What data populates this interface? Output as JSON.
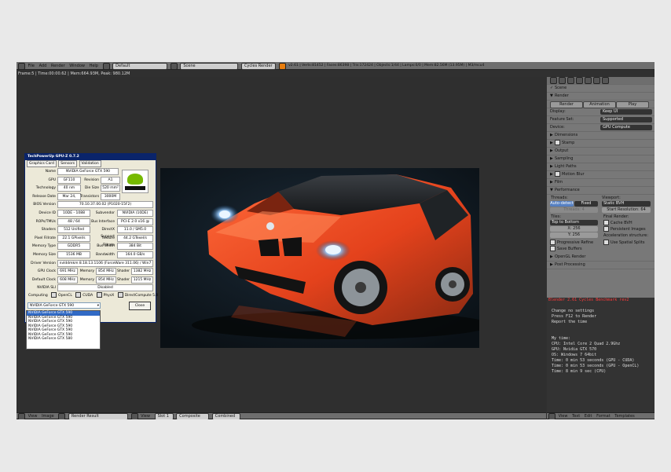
{
  "topbar": {
    "menus": [
      "File",
      "Add",
      "Render",
      "Window",
      "Help"
    ],
    "screen": "Default",
    "scene": "Scene",
    "engine": "Cycles Render",
    "stats": "v2.61 | Verts:81452 | Faces:86398 | Tris:172424 | Objects:1/44 | Lamps:0/0 | Mem:82.56M (13.95M) | M3/mcu4"
  },
  "viewport_info": "Frame:5 | Time:00:00.62 | Mem:664.93M, Peak: 980.12M",
  "gpuz": {
    "title": "TechPowerUp GPU-Z 0.7.2",
    "tabs": [
      "Graphics Card",
      "Sensors",
      "Validation"
    ],
    "rows": [
      {
        "l": "Name",
        "v": "NVIDIA GeForce GTX 590"
      },
      {
        "l": "GPU",
        "v": "GF110",
        "l2": "Revision",
        "v2": "A1"
      },
      {
        "l": "Technology",
        "v": "40 nm",
        "l2": "Die Size",
        "v2": "520 mm²"
      },
      {
        "l": "Release Date",
        "v": "Mar 24, 2011",
        "l2": "Transistors",
        "v2": "3000M"
      },
      {
        "l": "BIOS Version",
        "v": "70.10.37.00.02 (P1020-15F2)"
      },
      {
        "l": "Device ID",
        "v": "10DE - 1088",
        "l2": "Subvendor",
        "v2": "NVIDIA (10DE)"
      },
      {
        "l": "ROPs/TMUs",
        "v": "48 / 64",
        "l2": "Bus Interface",
        "v2": "PCI-E 2.0 x16 @ x16 1.1"
      },
      {
        "l": "Shaders",
        "v": "512 Unified",
        "l2": "DirectX Support",
        "v2": "11.0 / SM5.0"
      },
      {
        "l": "Pixel Fillrate",
        "v": "22.1 GPixel/s",
        "l2": "Texture Fillrate",
        "v2": "44.2 GTexel/s"
      },
      {
        "l": "Memory Type",
        "v": "GDDR5",
        "l2": "Bus Width",
        "v2": "384 Bit"
      },
      {
        "l": "Memory Size",
        "v": "1536 MB",
        "l2": "Bandwidth",
        "v2": "164.0 GB/s"
      },
      {
        "l": "Driver Version",
        "v": "nvlddmkm 8.18.13.1106 (ForceWare 311.06) / Win7 64"
      },
      {
        "l": "GPU Clock",
        "v": "691 MHz",
        "l2": "Memory",
        "v2": "854 MHz",
        "l3": "Shader",
        "v3": "1382 MHz"
      },
      {
        "l": "Default Clock",
        "v": "608 MHz",
        "l2": "Memory",
        "v2": "854 MHz",
        "l3": "Shader",
        "v3": "1215 MHz"
      },
      {
        "l": "NVIDIA SLI",
        "v": "Disabled"
      }
    ],
    "computing_label": "Computing",
    "computing": [
      "OpenCL",
      "CUDA",
      "PhysX",
      "DirectCompute 5.0"
    ],
    "select_value": "NVIDIA GeForce GTX 590",
    "close_label": "Close",
    "options": [
      "NVIDIA GeForce GTX 590",
      "NVIDIA GeForce GTX 590",
      "NVIDIA GeForce GTX 590",
      "NVIDIA GeForce GTX 590",
      "NVIDIA GeForce GTX 590",
      "NVIDIA GeForce GTX 590",
      "NVIDIA GeForce GTX 580"
    ]
  },
  "props": {
    "scene": "Scene",
    "render_header": "Render",
    "buttons": [
      "Render",
      "Animation",
      "Play"
    ],
    "display_label": "Display:",
    "display": "Keep UI",
    "feature_label": "Feature Set:",
    "feature": "Supported",
    "device_label": "Device:",
    "device": "GPU Compute",
    "panels": [
      "Dimensions",
      "Stamp",
      "Output",
      "Sampling",
      "Light Paths",
      "Motion Blur",
      "Film",
      "Performance"
    ],
    "threads_label": "Threads:",
    "auto": "Auto-detect",
    "fixed": "Fixed",
    "threads_val": "Threads: 4",
    "viewport_label": "Viewport:",
    "bvh": "Static BVH",
    "start_res": "Start Resolution: 64",
    "tiles_label": "Tiles:",
    "order": "Top to Bottom",
    "tx": "X: 256",
    "ty": "Y: 256",
    "final_label": "Final Render:",
    "cache": "Cache BVH",
    "persist": "Persistent Images",
    "prog": "Progressive Refine",
    "save": "Save Buffers",
    "accel_label": "Acceleration structure:",
    "spatial": "Use Spatial Splits",
    "panels2": [
      "OpenGL Render",
      "Post Processing"
    ]
  },
  "console": {
    "lines": [
      "Blender 2.61 Cycles Benchmark rev2",
      "",
      "Change no settings",
      "Press F12 to Render",
      "Report the time",
      "",
      "",
      "My time:",
      "CPU: Intel Core 2 Quad 2.9Ghz",
      "GPU: Nvidia GTX 570",
      "OS: Windows 7 64bit",
      "Time: 0 min 53 seconds (GPU - CUDA)",
      "Time: 0 min 53 seconds (GPU - OpenCL)",
      "Time: 8 min 9 sec (CPU)"
    ]
  },
  "bottombar": {
    "items": [
      "View",
      "Image",
      "Render Result",
      "View",
      "Slot 1",
      "Composite",
      "Combined"
    ],
    "right": [
      "View",
      "Text",
      "Edit",
      "Format",
      "Templates"
    ]
  }
}
